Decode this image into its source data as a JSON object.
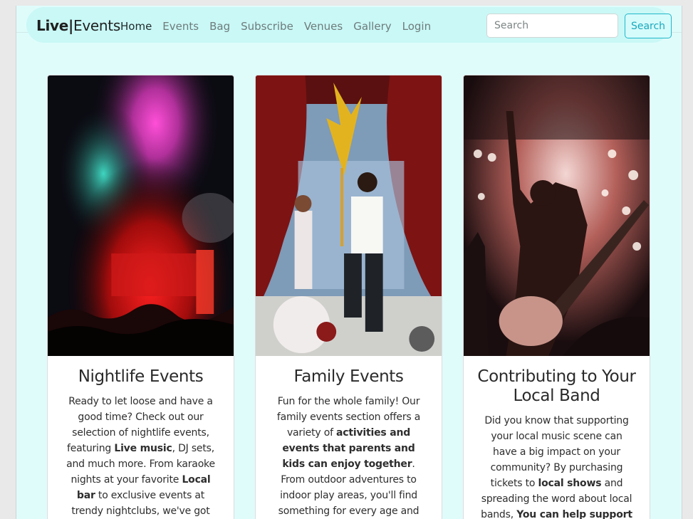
{
  "navbar": {
    "brand_bold": "Live",
    "brand_sep": "|",
    "brand_light": "Events",
    "links": [
      "Home",
      "Events",
      "Bag",
      "Subscribe",
      "Venues",
      "Gallery",
      "Login"
    ],
    "search_placeholder": "Search",
    "search_button": "Search"
  },
  "cards": [
    {
      "title": "Nightlife Events",
      "t1": "Ready to let loose and have a good time? Check out our selection of nightlife events, featuring ",
      "b1": "Live music",
      "t2": ", DJ sets, and much more. From karaoke nights at your favorite ",
      "b2": "Local bar",
      "t3": " to exclusive events at trendy nightclubs, we've got you covered."
    },
    {
      "title": "Family Events",
      "t1": "Fun for the whole family! Our family events section offers a variety of ",
      "b1": "activities and events that parents and kids can enjoy together",
      "t2": ". From outdoor adventures to indoor play areas, you'll find something for every age and interest."
    },
    {
      "title": "Contributing to Your Local Band",
      "t1": "Did you know that supporting your local music scene can have a big impact on your community? By purchasing tickets to ",
      "b1": "local shows",
      "t2": " and spreading the word about local bands, ",
      "b2": "You can help support"
    }
  ],
  "colors": {
    "page_bg": "#dffcfb",
    "navbar_bg": "#c9f8f6",
    "accent": "#19a9bd"
  }
}
